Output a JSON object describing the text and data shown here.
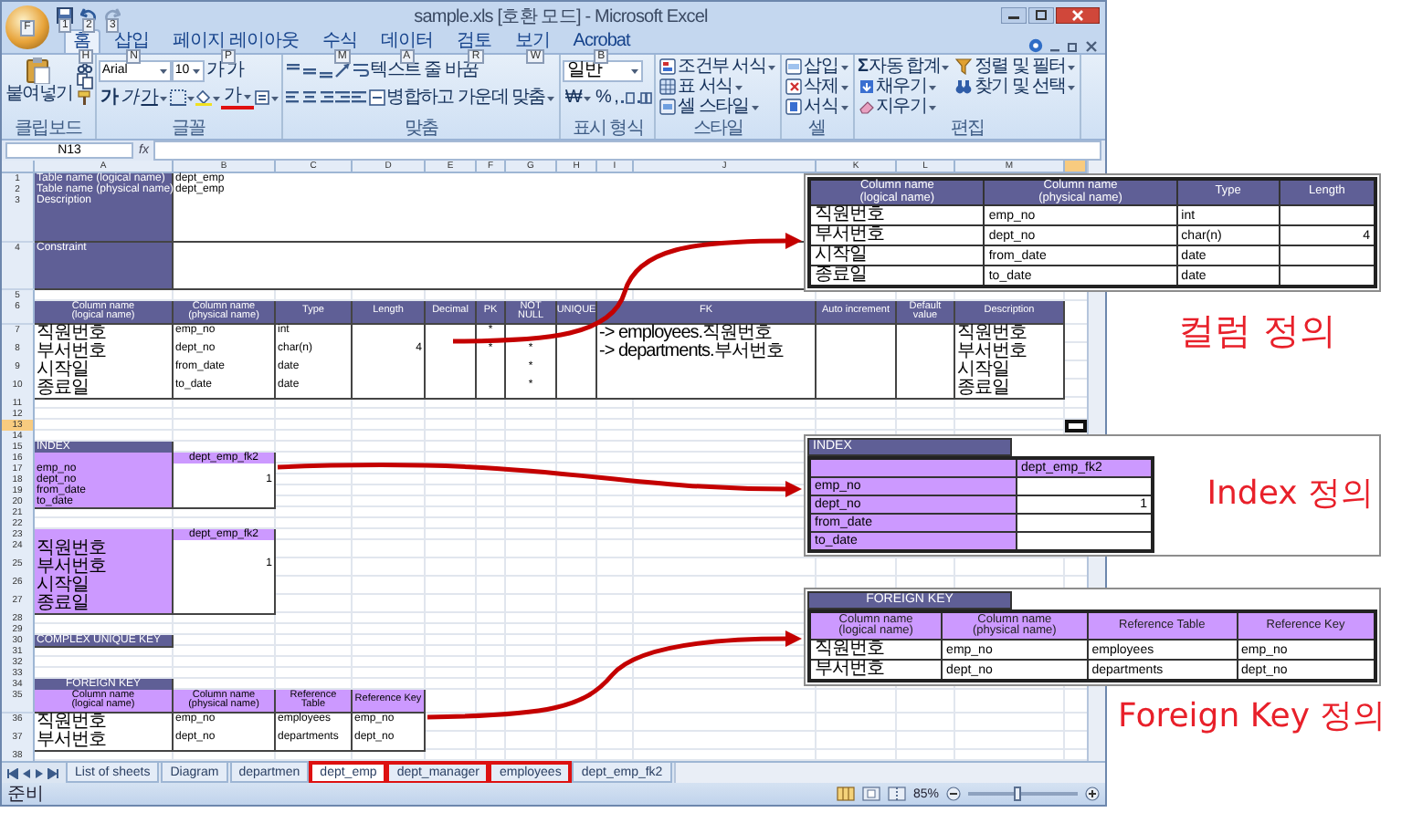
{
  "window": {
    "title": "sample.xls  [호환 모드] - Microsoft Excel",
    "office_keytip": "F",
    "quick_access_keytips": [
      "1",
      "2",
      "3"
    ]
  },
  "ribbon_tabs": [
    {
      "label": "홈",
      "keytip": "H",
      "selected": true
    },
    {
      "label": "삽입",
      "keytip": "N",
      "selected": false
    },
    {
      "label": "페이지 레이아웃",
      "keytip": "P",
      "selected": false
    },
    {
      "label": "수식",
      "keytip": "M",
      "selected": false
    },
    {
      "label": "데이터",
      "keytip": "A",
      "selected": false
    },
    {
      "label": "검토",
      "keytip": "R",
      "selected": false
    },
    {
      "label": "보기",
      "keytip": "W",
      "selected": false
    },
    {
      "label": "Acrobat",
      "keytip": "B",
      "selected": false
    }
  ],
  "ribbon": {
    "groups": [
      {
        "kind": "clipboard",
        "label": "클립보드",
        "buttons": [
          "붙여넣기"
        ]
      },
      {
        "kind": "font",
        "label": "글꼴",
        "font": "Arial",
        "size": "10",
        "buttons": [
          "가",
          "가",
          "가",
          "가",
          "가",
          "가"
        ]
      },
      {
        "kind": "alignment",
        "label": "맞춤",
        "buttons": [
          "텍스트 줄 바꿈",
          "병합하고 가운데 맞춤"
        ]
      },
      {
        "kind": "number",
        "label": "표시 형식",
        "format": "일반",
        "buttons": [
          "₩",
          "%",
          ","
        ]
      },
      {
        "kind": "styles",
        "label": "스타일",
        "buttons": [
          "조건부 서식",
          "표 서식",
          "셀 스타일"
        ]
      },
      {
        "kind": "cells",
        "label": "셀",
        "buttons": [
          "삽입",
          "삭제",
          "서식"
        ]
      },
      {
        "kind": "editing",
        "label": "편집",
        "sum_sign": "Σ",
        "buttons": [
          "자동 합계",
          "채우기",
          "지우기",
          "정렬 및 필터",
          "찾기 및 선택"
        ]
      }
    ]
  },
  "formula_bar": {
    "name_box": "N13",
    "function_label": "fx"
  },
  "sheet": {
    "columns": [
      "A",
      "B",
      "C",
      "D",
      "E",
      "F",
      "G",
      "H",
      "I",
      "J",
      "K",
      "L",
      "M"
    ],
    "rows": [
      {
        "number": "1",
        "selected": false,
        "cells": [
          {
            "kind": "title",
            "text": "Table name (logical name)"
          },
          {
            "kind": "field",
            "text": "dept_emp"
          }
        ]
      },
      {
        "number": "2",
        "selected": false,
        "cells": [
          {
            "kind": "title",
            "text": "Table name (physical name)"
          },
          {
            "kind": "field",
            "text": "dept_emp"
          }
        ]
      },
      {
        "number": "3",
        "selected": false,
        "cells": [
          {
            "kind": "area-title",
            "text": "Description"
          },
          {
            "kind": "area-field"
          }
        ]
      },
      {
        "number": "4",
        "selected": false,
        "cells": [
          {
            "kind": "area-title",
            "text": "Constraint"
          },
          {
            "kind": "area-field"
          }
        ]
      },
      {
        "number": "5",
        "selected": false
      },
      {
        "number": "6",
        "selected": false,
        "cells": [
          {
            "kind": "header",
            "text": "Column name\n(logical name)"
          },
          {
            "kind": "header",
            "text": "Column name\n(physical name)"
          },
          {
            "kind": "header",
            "text": "Type"
          },
          {
            "kind": "header",
            "text": "Length"
          },
          {
            "kind": "header",
            "text": "Decimal"
          },
          {
            "kind": "header",
            "text": "PK"
          },
          {
            "kind": "header",
            "text": "NOT NULL"
          },
          {
            "kind": "header",
            "text": "UNIQUE"
          },
          {
            "kind": "header2",
            "text": "FK"
          },
          {
            "kind": "header",
            "text": "Auto increment"
          },
          {
            "kind": "header",
            "text": "Default\nvalue"
          },
          {
            "kind": "header",
            "text": "Description"
          }
        ]
      },
      {
        "number": "7",
        "selected": false,
        "cells": [
          {
            "kind": "name",
            "text": "직원번호"
          },
          {
            "kind": "cell",
            "text": "emp_no"
          },
          {
            "kind": "cell",
            "text": "int"
          },
          {
            "kind": "cell"
          },
          {
            "kind": "cell"
          },
          {
            "kind": "center",
            "text": "*"
          },
          {
            "kind": "cell"
          },
          {
            "kind": "cell"
          },
          {
            "kind": "cell2",
            "text": "-> employees.직원번호"
          },
          {
            "kind": "cell"
          },
          {
            "kind": "cell"
          },
          {
            "kind": "name",
            "text": "직원번호"
          }
        ]
      },
      {
        "number": "8",
        "selected": false,
        "cells": [
          {
            "kind": "name",
            "text": "부서번호"
          },
          {
            "kind": "cell",
            "text": "dept_no"
          },
          {
            "kind": "cell",
            "text": "char(n)"
          },
          {
            "kind": "number",
            "text": "4"
          },
          {
            "kind": "cell"
          },
          {
            "kind": "center",
            "text": "*"
          },
          {
            "kind": "center",
            "text": "*"
          },
          {
            "kind": "cell"
          },
          {
            "kind": "cell2",
            "text": "-> departments.부서번호"
          },
          {
            "kind": "cell"
          },
          {
            "kind": "cell"
          },
          {
            "kind": "name",
            "text": "부서번호"
          }
        ]
      },
      {
        "number": "9",
        "selected": false,
        "cells": [
          {
            "kind": "name",
            "text": "시작일"
          },
          {
            "kind": "cell",
            "text": "from_date"
          },
          {
            "kind": "cell",
            "text": "date"
          },
          {
            "kind": "cell"
          },
          {
            "kind": "cell"
          },
          {
            "kind": "cell"
          },
          {
            "kind": "center",
            "text": "*"
          },
          {
            "kind": "cell"
          },
          {
            "kind": "cell2"
          },
          {
            "kind": "cell"
          },
          {
            "kind": "cell"
          },
          {
            "kind": "name",
            "text": "시작일"
          }
        ]
      },
      {
        "number": "10",
        "selected": false,
        "cells": [
          {
            "kind": "name",
            "text": "종료일"
          },
          {
            "kind": "cell",
            "text": "to_date"
          },
          {
            "kind": "cell",
            "text": "date"
          },
          {
            "kind": "cell"
          },
          {
            "kind": "cell"
          },
          {
            "kind": "cell"
          },
          {
            "kind": "center",
            "text": "*"
          },
          {
            "kind": "cell"
          },
          {
            "kind": "cell2"
          },
          {
            "kind": "cell"
          },
          {
            "kind": "cell"
          },
          {
            "kind": "name",
            "text": "종료일"
          }
        ]
      },
      {
        "number": "11",
        "selected": false
      },
      {
        "number": "12",
        "selected": false
      },
      {
        "number": "13",
        "selected": true
      },
      {
        "number": "14",
        "selected": false
      },
      {
        "number": "15",
        "selected": false,
        "cells": [
          {
            "kind": "banner",
            "text": "INDEX"
          }
        ]
      },
      {
        "number": "16",
        "selected": false,
        "cells": [
          {
            "kind": "tag"
          },
          {
            "kind": "tag-title",
            "text": "dept_emp_fk2"
          }
        ]
      },
      {
        "number": "17",
        "selected": false,
        "cells": [
          {
            "kind": "tag",
            "text": "emp_no"
          },
          {
            "kind": "cell"
          }
        ]
      },
      {
        "number": "18",
        "selected": false,
        "cells": [
          {
            "kind": "tag",
            "text": "dept_no"
          },
          {
            "kind": "number",
            "text": "1"
          }
        ]
      },
      {
        "number": "19",
        "selected": false,
        "cells": [
          {
            "kind": "tag",
            "text": "from_date"
          },
          {
            "kind": "cell"
          }
        ]
      },
      {
        "number": "20",
        "selected": false,
        "cells": [
          {
            "kind": "tag",
            "text": "to_date"
          },
          {
            "kind": "cell"
          }
        ]
      },
      {
        "number": "21",
        "selected": false
      },
      {
        "number": "22",
        "selected": false
      },
      {
        "number": "23",
        "selected": false,
        "cells": [
          {
            "kind": "tag"
          },
          {
            "kind": "tag-title",
            "text": "dept_emp_fk2"
          }
        ]
      },
      {
        "number": "24",
        "selected": false,
        "cells": [
          {
            "kind": "tag-name",
            "text": "직원번호"
          },
          {
            "kind": "cell"
          }
        ]
      },
      {
        "number": "25",
        "selected": false,
        "cells": [
          {
            "kind": "tag-name",
            "text": "부서번호"
          },
          {
            "kind": "number",
            "text": "1"
          }
        ]
      },
      {
        "number": "26",
        "selected": false,
        "cells": [
          {
            "kind": "tag-name",
            "text": "시작일"
          },
          {
            "kind": "cell"
          }
        ]
      },
      {
        "number": "27",
        "selected": false,
        "cells": [
          {
            "kind": "tag-name",
            "text": "종료일"
          },
          {
            "kind": "cell"
          }
        ]
      },
      {
        "number": "28",
        "selected": false
      },
      {
        "number": "29",
        "selected": false
      },
      {
        "number": "30",
        "selected": false,
        "cells": [
          {
            "kind": "banner",
            "text": "COMPLEX UNIQUE KEY"
          }
        ]
      },
      {
        "number": "31",
        "selected": false
      },
      {
        "number": "32",
        "selected": false
      },
      {
        "number": "33",
        "selected": false
      },
      {
        "number": "34",
        "selected": false,
        "cells": [
          {
            "kind": "caption",
            "text": "FOREIGN KEY"
          }
        ]
      },
      {
        "number": "35",
        "selected": false,
        "cells": [
          {
            "kind": "tag-header",
            "text": "Column name\n(logical name)"
          },
          {
            "kind": "tag-header",
            "text": "Column name\n(physical name)"
          },
          {
            "kind": "tag-header",
            "text": "Reference Table"
          },
          {
            "kind": "tag-header",
            "text": "Reference Key"
          }
        ]
      },
      {
        "number": "36",
        "selected": false,
        "cells": [
          {
            "kind": "name",
            "text": "직원번호"
          },
          {
            "kind": "cell",
            "text": "emp_no"
          },
          {
            "kind": "cell",
            "text": "employees"
          },
          {
            "kind": "cell",
            "text": "emp_no"
          }
        ]
      },
      {
        "number": "37",
        "selected": false,
        "cells": [
          {
            "kind": "name",
            "text": "부서번호"
          },
          {
            "kind": "cell",
            "text": "dept_no"
          },
          {
            "kind": "cell",
            "text": "departments"
          },
          {
            "kind": "cell",
            "text": "dept_no"
          }
        ]
      },
      {
        "number": "38",
        "selected": false
      }
    ]
  },
  "sheet_tabs": [
    {
      "label": "List of sheets",
      "selected": false,
      "annotated": false
    },
    {
      "label": "Diagram",
      "selected": false,
      "annotated": false
    },
    {
      "label": "departmen",
      "selected": false,
      "annotated": false
    },
    {
      "label": "dept_emp",
      "selected": true,
      "annotated": true
    },
    {
      "label": "dept_manager",
      "selected": false,
      "annotated": true
    },
    {
      "label": "employees",
      "selected": false,
      "annotated": true
    },
    {
      "label": "dept_emp_fk2",
      "selected": false,
      "annotated": false
    }
  ],
  "status_bar": {
    "status": "준비",
    "zoom": "85%",
    "level": 0.45
  },
  "callouts": [
    {
      "kind": "columns",
      "columns": [
        "Column name\n(logical name)",
        "Column name\n(physical name)",
        "Type",
        "Length"
      ],
      "caption": "컬럼 정의",
      "rows": [
        {
          "logical": "직원번호",
          "physical": "emp_no",
          "type": "int"
        },
        {
          "logical": "부서번호",
          "physical": "dept_no",
          "type": "char(n)",
          "length": "4"
        },
        {
          "logical": "시작일",
          "physical": "from_date",
          "type": "date"
        },
        {
          "logical": "종료일",
          "physical": "to_date",
          "type": "date"
        }
      ]
    },
    {
      "kind": "index",
      "title": "INDEX",
      "index_name": "dept_emp_fk2",
      "caption": "Index 정의",
      "rows": [
        {
          "column": "emp_no"
        },
        {
          "column": "dept_no",
          "order": "1"
        },
        {
          "column": "from_date"
        },
        {
          "column": "to_date"
        }
      ]
    },
    {
      "kind": "foreign_key",
      "title": "FOREIGN KEY",
      "columns": [
        "Column name\n(logical name)",
        "Column name\n(physical name)",
        "Reference Table",
        "Reference Key"
      ],
      "caption": "Foreign Key 정의",
      "rows": [
        {
          "logical": "직원번호",
          "physical": "emp_no",
          "table": "employees",
          "key": "emp_no"
        },
        {
          "logical": "부서번호",
          "physical": "dept_no",
          "table": "departments",
          "key": "dept_no"
        }
      ]
    }
  ]
}
